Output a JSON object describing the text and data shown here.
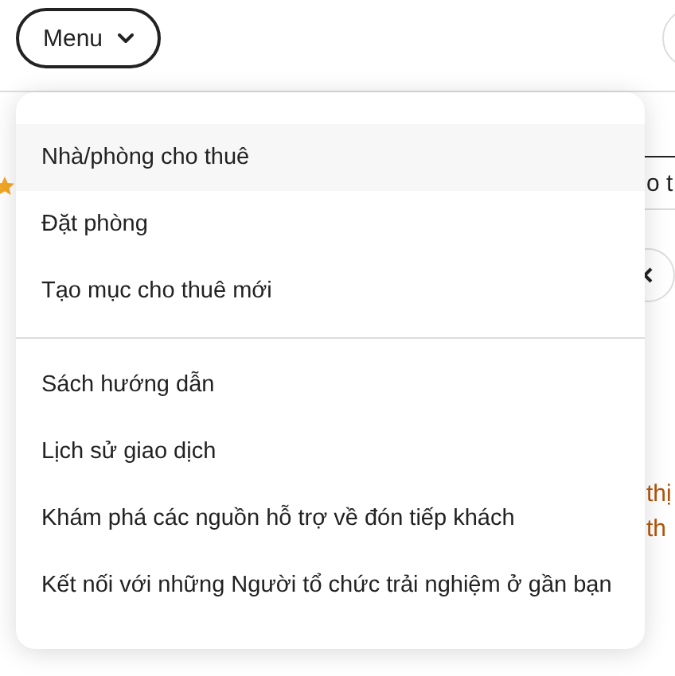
{
  "menu_button": {
    "label": "Menu",
    "expanded": true
  },
  "menu": {
    "groups": [
      {
        "items": [
          {
            "label": "Nhà/phòng cho thuê",
            "selected": true
          },
          {
            "label": "Đặt phòng",
            "selected": false
          },
          {
            "label": "Tạo mục cho thuê mới",
            "selected": false
          }
        ]
      },
      {
        "items": [
          {
            "label": "Sách hướng dẫn",
            "selected": false
          },
          {
            "label": "Lịch sử giao dịch",
            "selected": false
          },
          {
            "label": "Khám phá các nguồn hỗ trợ về đón tiếp khách",
            "selected": false
          },
          {
            "label": "Kết nối với những Người tổ chức trải nghiệm ở gần bạn",
            "selected": false
          }
        ]
      }
    ]
  },
  "background": {
    "tab_text": "o t",
    "lines": [
      "thị",
      "th"
    ]
  }
}
